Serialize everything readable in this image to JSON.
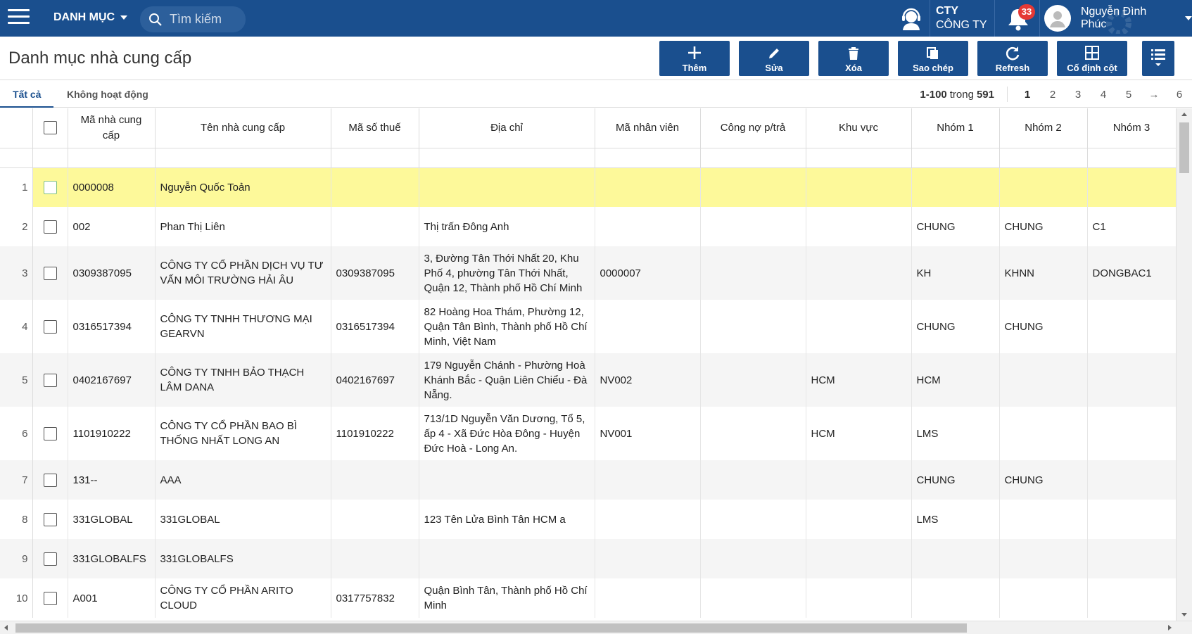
{
  "colors": {
    "brand": "#1a4f8e",
    "selected_row": "#fdf99a",
    "badge": "#e53935"
  },
  "topbar": {
    "menu_label": "DANH MỤC",
    "search_placeholder": "Tìm kiếm",
    "company_line1": "CTY",
    "company_line2": "CÔNG TY",
    "notification_count": "33",
    "user_name": "Nguyễn Đình Phúc"
  },
  "page": {
    "title": "Danh mục nhà cung cấp"
  },
  "toolbar": {
    "add": "Thêm",
    "edit": "Sửa",
    "delete": "Xóa",
    "copy": "Sao chép",
    "refresh": "Refresh",
    "freeze": "Cố định cột"
  },
  "tabs": {
    "all": "Tất cả",
    "inactive": "Không hoạt động"
  },
  "pager": {
    "range": "1-100",
    "of": "trong",
    "total": "591",
    "pages": [
      "1",
      "2",
      "3",
      "4",
      "5",
      "→",
      "6"
    ]
  },
  "columns": [
    "Mã nhà cung cấp",
    "Tên nhà cung cấp",
    "Mã số thuế",
    "Địa chỉ",
    "Mã nhân viên",
    "Công nợ p/trả",
    "Khu vực",
    "Nhóm 1",
    "Nhóm 2",
    "Nhóm 3"
  ],
  "rows": [
    [
      "1",
      "0000008",
      "Nguyễn Quốc Toản",
      "",
      "",
      "",
      "",
      "",
      "",
      "",
      ""
    ],
    [
      "2",
      "002",
      "Phan Thị Liên",
      "",
      "Thị trấn Đông Anh",
      "",
      "",
      "",
      "CHUNG",
      "CHUNG",
      "C1"
    ],
    [
      "3",
      "0309387095",
      "CÔNG TY CỔ PHẦN DỊCH VỤ TƯ VẤN MÔI TRƯỜNG HẢI ÂU",
      "0309387095",
      "3, Đường Tân Thới Nhất 20,  Khu Phố 4, phường Tân Thới Nhất, Quận 12, Thành phố Hồ Chí Minh",
      "0000007",
      "",
      "",
      "KH",
      "KHNN",
      "DONGBAC1"
    ],
    [
      "4",
      "0316517394",
      "CÔNG TY TNHH THƯƠNG MẠI GEARVN",
      "0316517394",
      "82 Hoàng Hoa Thám, Phường 12, Quận Tân Bình, Thành phố Hồ Chí Minh, Việt Nam",
      "",
      "",
      "",
      "CHUNG",
      "CHUNG",
      ""
    ],
    [
      "5",
      "0402167697",
      "CÔNG TY TNHH BẢO THẠCH LÂM DANA",
      "0402167697",
      "179 Nguyễn Chánh - Phường Hoà Khánh Bắc - Quận Liên Chiểu - Đà Nẵng.",
      "NV002",
      "",
      "HCM",
      "HCM",
      "",
      ""
    ],
    [
      "6",
      "1101910222",
      "CÔNG TY CỔ PHẦN BAO BÌ THỐNG NHẤT LONG AN",
      "1101910222",
      "713/1D Nguyễn Văn Dương, Tổ 5, ấp 4 - Xã Đức Hòa Đông - Huyện Đức Hoà - Long An.",
      "NV001",
      "",
      "HCM",
      "LMS",
      "",
      ""
    ],
    [
      "7",
      "131--",
      "AAA",
      "",
      "",
      "",
      "",
      "",
      "CHUNG",
      "CHUNG",
      ""
    ],
    [
      "8",
      "331GLOBAL",
      "331GLOBAL",
      "",
      "123 Tên Lửa Bình Tân HCM a",
      "",
      "",
      "",
      "LMS",
      "",
      ""
    ],
    [
      "9",
      "331GLOBALFS",
      "331GLOBALFS",
      "",
      "",
      "",
      "",
      "",
      "",
      "",
      ""
    ],
    [
      "10",
      "A001",
      "CÔNG TY CỔ PHẦN ARITO CLOUD",
      "0317757832",
      "Quận Bình Tân, Thành phố Hồ Chí Minh",
      "",
      "",
      "",
      "",
      "",
      ""
    ]
  ]
}
